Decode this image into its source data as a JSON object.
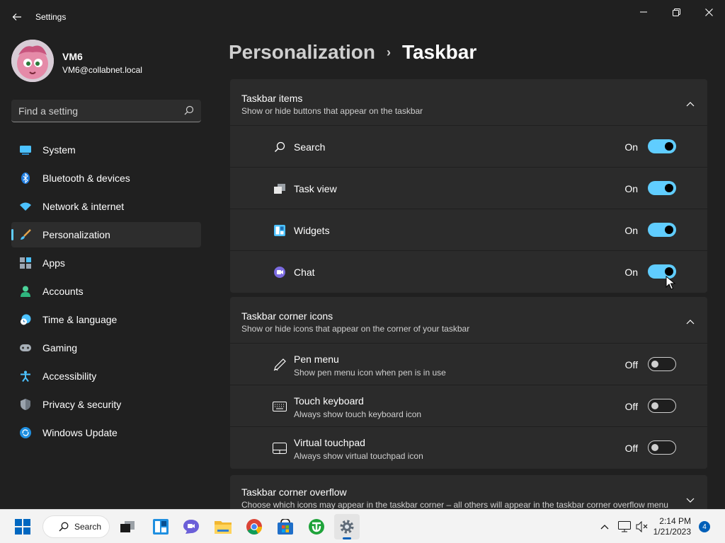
{
  "window": {
    "title": "Settings",
    "controls": {
      "minimize": "minimize-icon",
      "maximize": "restore-icon",
      "close": "close-icon"
    }
  },
  "profile": {
    "name": "VM6",
    "email": "VM6@collabnet.local"
  },
  "search": {
    "placeholder": "Find a setting"
  },
  "sidebar": {
    "items": [
      {
        "label": "System",
        "icon": "monitor-icon",
        "active": false
      },
      {
        "label": "Bluetooth & devices",
        "icon": "bluetooth-icon",
        "active": false
      },
      {
        "label": "Network & internet",
        "icon": "wifi-icon",
        "active": false
      },
      {
        "label": "Personalization",
        "icon": "brush-icon",
        "active": true
      },
      {
        "label": "Apps",
        "icon": "apps-icon",
        "active": false
      },
      {
        "label": "Accounts",
        "icon": "person-icon",
        "active": false
      },
      {
        "label": "Time & language",
        "icon": "clock-globe-icon",
        "active": false
      },
      {
        "label": "Gaming",
        "icon": "controller-icon",
        "active": false
      },
      {
        "label": "Accessibility",
        "icon": "accessibility-icon",
        "active": false
      },
      {
        "label": "Privacy & security",
        "icon": "shield-icon",
        "active": false
      },
      {
        "label": "Windows Update",
        "icon": "update-icon",
        "active": false
      }
    ]
  },
  "breadcrumb": {
    "parent": "Personalization",
    "separator": "›",
    "current": "Taskbar"
  },
  "taskbar_items": {
    "title": "Taskbar items",
    "subtitle": "Show or hide buttons that appear on the taskbar",
    "rows": [
      {
        "label": "Search",
        "state": "On",
        "icon": "search-icon"
      },
      {
        "label": "Task view",
        "state": "On",
        "icon": "task-view-icon"
      },
      {
        "label": "Widgets",
        "state": "On",
        "icon": "widgets-icon"
      },
      {
        "label": "Chat",
        "state": "On",
        "icon": "chat-icon"
      }
    ]
  },
  "corner_icons": {
    "title": "Taskbar corner icons",
    "subtitle": "Show or hide icons that appear on the corner of your taskbar",
    "rows": [
      {
        "label": "Pen menu",
        "sub": "Show pen menu icon when pen is in use",
        "state": "Off",
        "icon": "pen-icon"
      },
      {
        "label": "Touch keyboard",
        "sub": "Always show touch keyboard icon",
        "state": "Off",
        "icon": "keyboard-icon"
      },
      {
        "label": "Virtual touchpad",
        "sub": "Always show virtual touchpad icon",
        "state": "Off",
        "icon": "touchpad-icon"
      }
    ]
  },
  "corner_overflow": {
    "title": "Taskbar corner overflow",
    "subtitle": "Choose which icons may appear in the taskbar corner – all others will appear in the taskbar corner overflow menu"
  },
  "system_taskbar": {
    "search_label": "Search",
    "apps": [
      "start-icon",
      "task-view-icon",
      "widgets-icon",
      "chat-icon",
      "file-explorer-icon",
      "chrome-icon",
      "store-icon",
      "utorrent-icon",
      "settings-icon"
    ],
    "time": "2:14 PM",
    "date": "1/21/2023",
    "notifications": "4"
  },
  "colors": {
    "accent": "#60cdff",
    "background": "#202020",
    "card": "#2b2b2b"
  }
}
